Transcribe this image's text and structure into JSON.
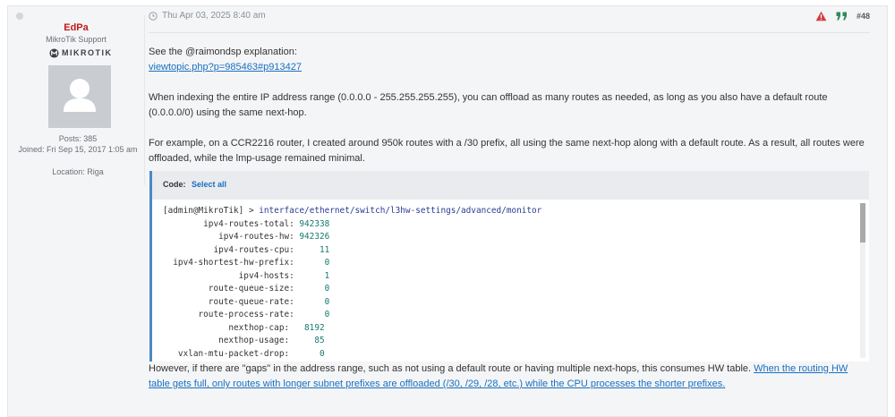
{
  "author": {
    "username": "EdPa",
    "rank": "MikroTik Support",
    "logo_text": "MIKROTIK",
    "posts": "Posts: 385",
    "joined": "Joined: Fri Sep 15, 2017 1:05 am",
    "location": "Location: Riga"
  },
  "post": {
    "date": "Thu Apr 03, 2025 8:40 am",
    "number": "#48",
    "para1": "See the @raimondsp explanation:",
    "link1": "viewtopic.php?p=985463#p913427",
    "para2": "When indexing the entire IP address range (0.0.0.0 - 255.255.255.255), you can offload as many routes as needed, as long as you also have a default route (0.0.0.0/0) using the same next-hop.",
    "para3": "For example, on a CCR2216 router, I created around 950k routes with a /30 prefix, all using the same next-hop along with a default route. As a result, all routes were offloaded, while the lmp-usage remained minimal.",
    "para4_text": "However, if there are \"gaps\" in the address range, such as not using a default route or having multiple next-hops, this consumes HW table.",
    "para4_link": "When the routing HW table gets full, only routes with longer subnet prefixes are offloaded (/30, /29, /28, etc.) while the CPU processes the shorter prefixes."
  },
  "code": {
    "title": "Code:",
    "select_all": "Select all",
    "prompt": "[admin@MikroTik] > ",
    "command": "interface/ethernet/switch/l3hw-settings/advanced/monitor",
    "lines": [
      {
        "key": "        ipv4-routes-total:",
        "val": " 942338"
      },
      {
        "key": "           ipv4-routes-hw:",
        "val": " 942326"
      },
      {
        "key": "          ipv4-routes-cpu:",
        "val": "     11"
      },
      {
        "key": "  ipv4-shortest-hw-prefix:",
        "val": "      0"
      },
      {
        "key": "               ipv4-hosts:",
        "val": "      1"
      },
      {
        "key": "         route-queue-size:",
        "val": "      0"
      },
      {
        "key": "         route-queue-rate:",
        "val": "      0"
      },
      {
        "key": "       route-process-rate:",
        "val": "      0"
      },
      {
        "key": "             nexthop-cap:",
        "val": "   8192"
      },
      {
        "key": "           nexthop-usage:",
        "val": "     85"
      },
      {
        "key": "   vxlan-mtu-packet-drop:",
        "val": "      0"
      }
    ]
  },
  "colors": {
    "username": "#c21b1b",
    "link": "#1a6fbf",
    "report": "#d23c3c",
    "quote": "#2e8b57"
  },
  "icons": [
    "clock-icon",
    "report-icon",
    "quote-icon",
    "avatar-placeholder-icon",
    "mikrotik-logo-icon"
  ]
}
